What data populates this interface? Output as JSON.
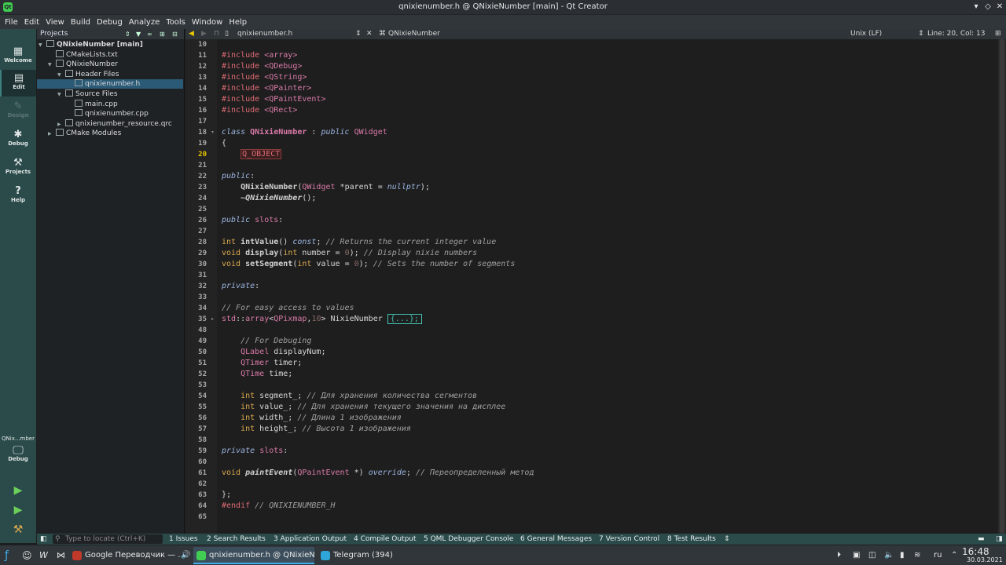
{
  "window": {
    "title": "qnixienumber.h @ QNixieNumber [main] - Qt Creator",
    "app_icon": "qt-icon"
  },
  "menu": [
    "File",
    "Edit",
    "View",
    "Build",
    "Debug",
    "Analyze",
    "Tools",
    "Window",
    "Help"
  ],
  "modes": [
    {
      "label": "Welcome",
      "icon": "grid-icon",
      "active": false
    },
    {
      "label": "Edit",
      "icon": "document-icon",
      "active": true
    },
    {
      "label": "Design",
      "icon": "pencil-icon",
      "active": false,
      "disabled": true
    },
    {
      "label": "Debug",
      "icon": "bug-icon",
      "active": false
    },
    {
      "label": "Projects",
      "icon": "wrench-icon",
      "active": false
    },
    {
      "label": "Help",
      "icon": "help-icon",
      "active": false
    }
  ],
  "kit": {
    "label": "QNix...mber",
    "mode": "Debug"
  },
  "projects": {
    "header": "Projects",
    "tree": [
      {
        "label": "QNixieNumber [main]",
        "level": 0,
        "arrow": "▼",
        "bold": true
      },
      {
        "label": "CMakeLists.txt",
        "level": 1,
        "arrow": ""
      },
      {
        "label": "QNixieNumber",
        "level": 1,
        "arrow": "▼"
      },
      {
        "label": "Header Files",
        "level": 2,
        "arrow": "▼"
      },
      {
        "label": "qnixienumber.h",
        "level": 3,
        "arrow": "",
        "selected": true
      },
      {
        "label": "Source Files",
        "level": 2,
        "arrow": "▼"
      },
      {
        "label": "main.cpp",
        "level": 3,
        "arrow": ""
      },
      {
        "label": "qnixienumber.cpp",
        "level": 3,
        "arrow": ""
      },
      {
        "label": "qnixienumber_resource.qrc",
        "level": 2,
        "arrow": "▶"
      },
      {
        "label": "CMake Modules",
        "level": 1,
        "arrow": "▶"
      }
    ]
  },
  "editor_toolbar": {
    "file": "qnixienumber.h",
    "symbol": "QNixieNumber",
    "line_ending": "Unix (LF)",
    "position": "Line: 20, Col: 13"
  },
  "code": {
    "current_line": "20",
    "lines": [
      {
        "n": "10",
        "html": ""
      },
      {
        "n": "11",
        "html": "<span class='pp'>#include</span> <span class='inc'>&lt;array&gt;</span>"
      },
      {
        "n": "12",
        "html": "<span class='pp'>#include</span> <span class='inc'>&lt;QDebug&gt;</span>"
      },
      {
        "n": "13",
        "html": "<span class='pp'>#include</span> <span class='inc'>&lt;QString&gt;</span>"
      },
      {
        "n": "14",
        "html": "<span class='pp'>#include</span> <span class='inc'>&lt;QPainter&gt;</span>"
      },
      {
        "n": "15",
        "html": "<span class='pp'>#include</span> <span class='inc'>&lt;QPaintEvent&gt;</span>"
      },
      {
        "n": "16",
        "html": "<span class='pp'>#include</span> <span class='inc'>&lt;QRect&gt;</span>"
      },
      {
        "n": "17",
        "html": ""
      },
      {
        "n": "18",
        "html": "<span class='kw'>class</span> <span class='cls'><b>QNixieNumber</b></span> : <span class='kw'>public</span> <span class='ty'>QWidget</span>",
        "fold": "▾"
      },
      {
        "n": "19",
        "html": "{"
      },
      {
        "n": "20",
        "html": "    <span class='mac'>Q_OBJECT</span>"
      },
      {
        "n": "21",
        "html": ""
      },
      {
        "n": "22",
        "html": "<span class='kw'>public</span>:"
      },
      {
        "n": "23",
        "html": "    <span class='fn'>QNixieNumber</span>(<span class='ty'>QWidget</span> *parent = <span class='kw'>nullptr</span>);"
      },
      {
        "n": "24",
        "html": "    <span class='fni'>~QNixieNumber</span>();"
      },
      {
        "n": "25",
        "html": ""
      },
      {
        "n": "26",
        "html": "<span class='kw'>public</span> <span class='ty'>slots</span>:"
      },
      {
        "n": "27",
        "html": ""
      },
      {
        "n": "28",
        "html": "<span class='kw2'>int</span> <span class='fn'>intValue</span>() <span class='kw'>const</span>; <span class='cm'>// Returns the current integer value</span>"
      },
      {
        "n": "29",
        "html": "<span class='kw2'>void</span> <span class='fn'>display</span>(<span class='kw2'>int</span> number = <span class='num'>0</span>); <span class='cm'>// Display nixie numbers</span>"
      },
      {
        "n": "30",
        "html": "<span class='kw2'>void</span> <span class='fn'>setSegment</span>(<span class='kw2'>int</span> value = <span class='num'>0</span>); <span class='cm'>// Sets the number of segments</span>"
      },
      {
        "n": "31",
        "html": ""
      },
      {
        "n": "32",
        "html": "<span class='kw'>private</span>:"
      },
      {
        "n": "33",
        "html": ""
      },
      {
        "n": "34",
        "html": "<span class='cm'>// For easy access to values</span>"
      },
      {
        "n": "35",
        "html": "<span class='ty'>std</span>::<span class='ty'>array</span>&lt;<span class='ty'>QPixmap</span>,<span class='num'>10</span>&gt; NixieNumber <span class='fold'>{...};</span>",
        "fold": "▸"
      },
      {
        "n": "48",
        "html": ""
      },
      {
        "n": "49",
        "html": "    <span class='cm'>// For Debuging</span>"
      },
      {
        "n": "50",
        "html": "    <span class='ty'>QLabel</span> displayNum;"
      },
      {
        "n": "51",
        "html": "    <span class='ty'>QTimer</span> timer;"
      },
      {
        "n": "52",
        "html": "    <span class='ty'>QTime</span> time;"
      },
      {
        "n": "53",
        "html": ""
      },
      {
        "n": "54",
        "html": "    <span class='kw2'>int</span> segment_; <span class='cm'>// Для хранения количества сегментов</span>"
      },
      {
        "n": "55",
        "html": "    <span class='kw2'>int</span> value_; <span class='cm'>// Для хранения текущего значения на дисплее</span>"
      },
      {
        "n": "56",
        "html": "    <span class='kw2'>int</span> width_; <span class='cm'>// Длина 1 изображения</span>"
      },
      {
        "n": "57",
        "html": "    <span class='kw2'>int</span> height_; <span class='cm'>// Высота 1 изображения</span>"
      },
      {
        "n": "58",
        "html": ""
      },
      {
        "n": "59",
        "html": "<span class='kw'>private</span> <span class='ty'>slots</span>:"
      },
      {
        "n": "60",
        "html": ""
      },
      {
        "n": "61",
        "html": "<span class='kw2'>void</span> <span class='fni'>paintEvent</span>(<span class='ty'>QPaintEvent</span> *) <span class='kw'>override</span>; <span class='cm'>// Переопределенный метод</span>"
      },
      {
        "n": "62",
        "html": ""
      },
      {
        "n": "63",
        "html": "};"
      },
      {
        "n": "64",
        "html": "<span class='pp'>#endif</span> <span class='cm'>// QNIXIENUMBER_H</span>"
      },
      {
        "n": "65",
        "html": ""
      }
    ]
  },
  "outputs": {
    "locate_placeholder": "Type to locate (Ctrl+K)",
    "tabs": [
      "1  Issues",
      "2  Search Results",
      "3  Application Output",
      "4  Compile Output",
      "5  QML Debugger Console",
      "6  General Messages",
      "7  Version Control",
      "8  Test Results"
    ]
  },
  "taskbar": {
    "tasks": [
      {
        "label": "Google Переводчик — ...",
        "icon_color": "#c0392b",
        "active": false
      },
      {
        "label": "qnixienumber.h @ QNixieNu...",
        "icon_color": "#41cd52",
        "active": true
      },
      {
        "label": "Telegram (394)",
        "icon_color": "#2ea6da",
        "active": false
      }
    ],
    "language": "ru",
    "time": "16:48",
    "date": "30.03.2021"
  }
}
